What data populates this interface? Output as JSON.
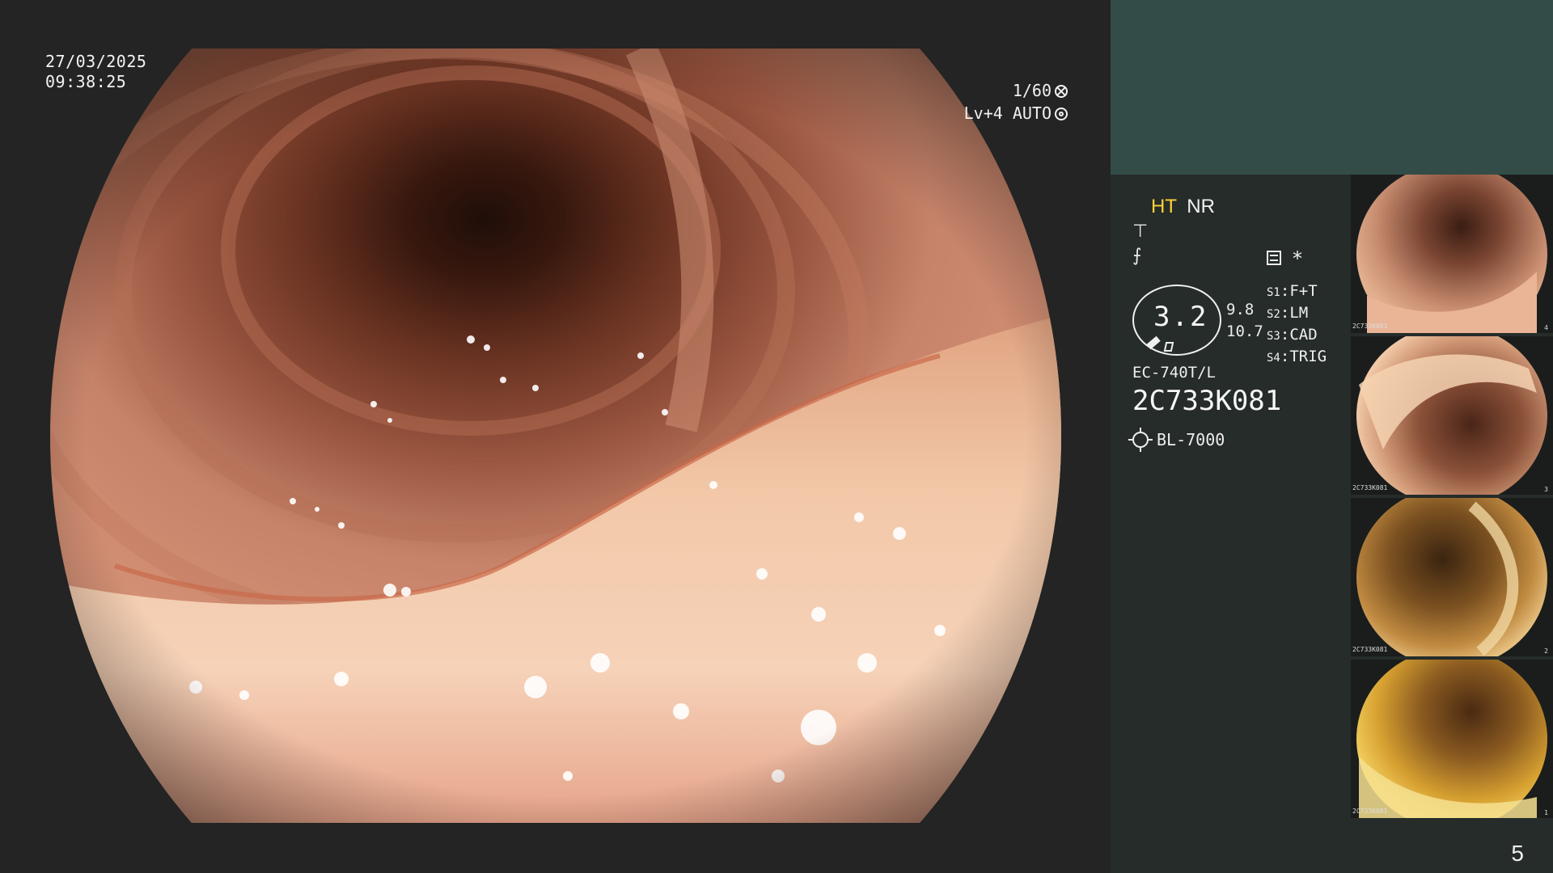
{
  "overlay": {
    "date": "27/03/2025",
    "time": "09:38:25",
    "shutter": "1/60",
    "level": "Lv+4",
    "mode": "AUTO",
    "icons": [
      "aperture-icon",
      "gear-icon"
    ]
  },
  "panel": {
    "mode_ht": "HT",
    "mode_nr": "NR",
    "symbol_1": "⊤",
    "symbol_2": "⨍",
    "asterisk": "*",
    "zoom": "3.2",
    "zoom_values": [
      "9.8",
      "10.7"
    ],
    "switches": [
      {
        "key": "S1",
        "value": "F+T"
      },
      {
        "key": "S2",
        "value": "LM"
      },
      {
        "key": "S3",
        "value": "CAD"
      },
      {
        "key": "S4",
        "value": "TRIG"
      }
    ],
    "scope_model": "EC-740T/L",
    "serial": "2C733K081",
    "light_source": "BL-7000",
    "page_number": "5",
    "colors": {
      "panel_bg": "#262c2a",
      "panel_top": "#334c48",
      "ht": "#ffd23a"
    }
  },
  "thumbnails": [
    {
      "serial": "2C733K081",
      "index": "4",
      "scene": "lumen"
    },
    {
      "serial": "2C733K081",
      "index": "3",
      "scene": "fold"
    },
    {
      "serial": "2C733K081",
      "index": "2",
      "scene": "stool"
    },
    {
      "serial": "2C733K081",
      "index": "1",
      "scene": "yellow"
    }
  ]
}
